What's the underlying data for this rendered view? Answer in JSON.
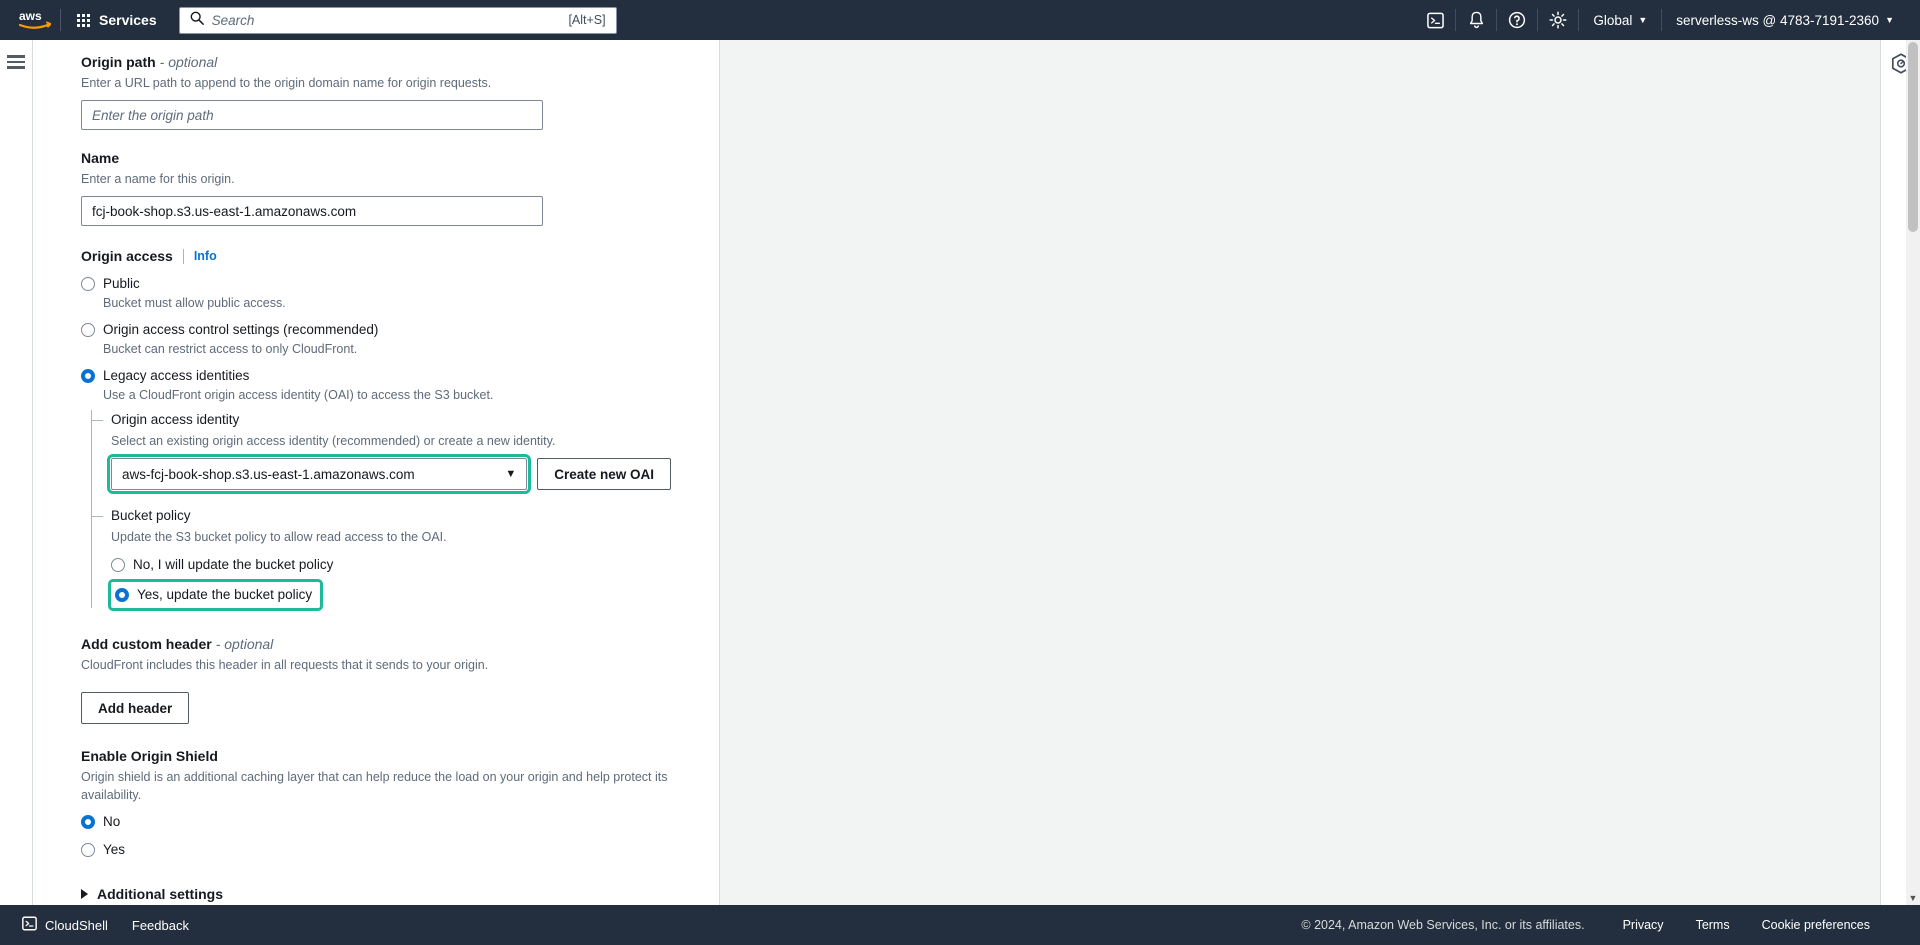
{
  "topnav": {
    "logo_alt": "aws",
    "services_label": "Services",
    "search_placeholder": "Search",
    "search_value": "",
    "search_shortcut": "[Alt+S]",
    "region_label": "Global",
    "account_label": "serverless-ws @ 4783-7191-2360",
    "icons": {
      "cloudshell": "cloudshell-icon",
      "notifications": "bell-icon",
      "help": "question-circle-icon",
      "settings": "gear-icon"
    }
  },
  "form": {
    "origin_path": {
      "label": "Origin path",
      "optional": "- optional",
      "description": "Enter a URL path to append to the origin domain name for origin requests.",
      "placeholder": "Enter the origin path",
      "value": ""
    },
    "name": {
      "label": "Name",
      "description": "Enter a name for this origin.",
      "value": "fcj-book-shop.s3.us-east-1.amazonaws.com"
    },
    "origin_access": {
      "label": "Origin access",
      "info_label": "Info",
      "options": [
        {
          "label": "Public",
          "description": "Bucket must allow public access.",
          "selected": false
        },
        {
          "label": "Origin access control settings (recommended)",
          "description": "Bucket can restrict access to only CloudFront.",
          "selected": false
        },
        {
          "label": "Legacy access identities",
          "description": "Use a CloudFront origin access identity (OAI) to access the S3 bucket.",
          "selected": true
        }
      ]
    },
    "origin_access_identity": {
      "label": "Origin access identity",
      "description": "Select an existing origin access identity (recommended) or create a new identity.",
      "selected_value": "aws-fcj-book-shop.s3.us-east-1.amazonaws.com",
      "create_button": "Create new OAI",
      "highlighted": true
    },
    "bucket_policy": {
      "label": "Bucket policy",
      "description": "Update the S3 bucket policy to allow read access to the OAI.",
      "options": [
        {
          "label": "No, I will update the bucket policy",
          "selected": false,
          "highlighted": false
        },
        {
          "label": "Yes, update the bucket policy",
          "selected": true,
          "highlighted": true
        }
      ]
    },
    "custom_header": {
      "label": "Add custom header",
      "optional": "- optional",
      "description": "CloudFront includes this header in all requests that it sends to your origin.",
      "button": "Add header"
    },
    "origin_shield": {
      "label": "Enable Origin Shield",
      "description": "Origin shield is an additional caching layer that can help reduce the load on your origin and help protect its availability.",
      "options": [
        {
          "label": "No",
          "selected": true
        },
        {
          "label": "Yes",
          "selected": false
        }
      ]
    },
    "additional_settings": {
      "label": "Additional settings",
      "expanded": false
    }
  },
  "footer": {
    "cloudshell_label": "CloudShell",
    "feedback_label": "Feedback",
    "copyright": "© 2024, Amazon Web Services, Inc. or its affiliates.",
    "links": [
      "Privacy",
      "Terms",
      "Cookie preferences"
    ]
  },
  "colors": {
    "nav_bg": "#232f3e",
    "accent_blue": "#0972d3",
    "highlight_green": "#1bbb9a",
    "page_bg": "#f2f3f3"
  }
}
